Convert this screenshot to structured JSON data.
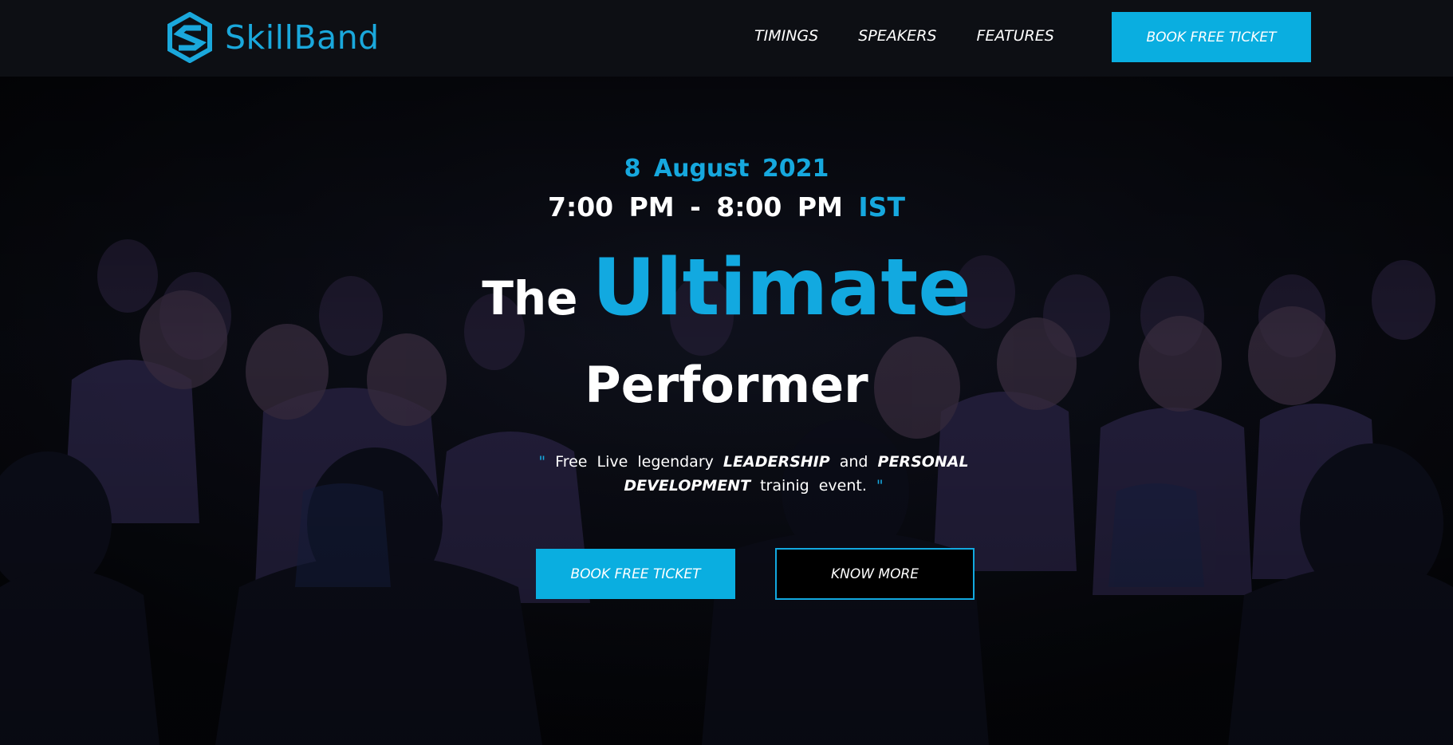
{
  "brand": {
    "name": "SkillBand",
    "logo_icon": "s-hexagon-logo-icon",
    "accent_color": "#12a9e0"
  },
  "nav": {
    "items": [
      {
        "label": "TIMINGS"
      },
      {
        "label": "SPEAKERS"
      },
      {
        "label": "FEATURES"
      }
    ],
    "cta_label": "BOOK FREE TICKET"
  },
  "hero": {
    "date": "8 August 2021",
    "time": "7:00 PM - 8:00 PM",
    "timezone": "IST",
    "title_the": "The",
    "title_highlight": "Ultimate",
    "title_line2": "Performer",
    "tagline": {
      "open_quote": "\"",
      "part1": "Free Live legendary",
      "em1": "LEADERSHIP",
      "part2": "and",
      "em2": "PERSONAL DEVELOPMENT",
      "part3": "trainig event.",
      "close_quote": "\""
    },
    "primary_button": "BOOK FREE TICKET",
    "secondary_button": "KNOW MORE",
    "background": "conference-audience-photo"
  }
}
